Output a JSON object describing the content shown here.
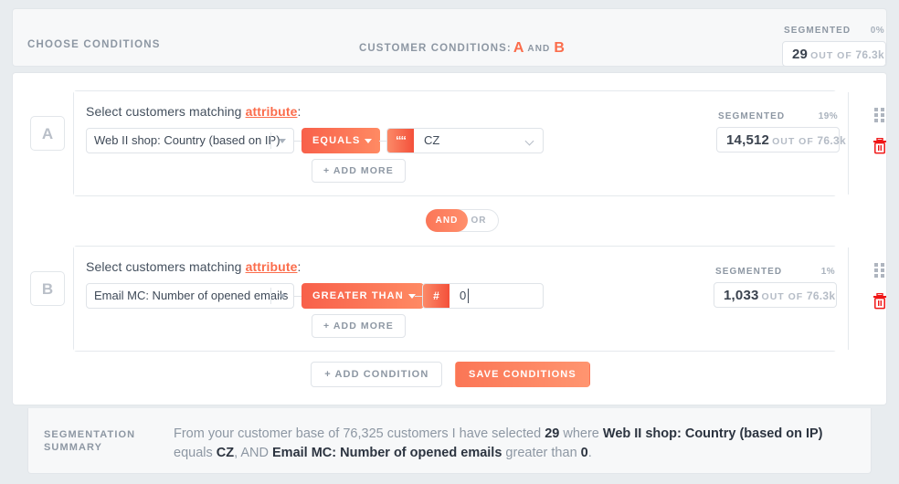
{
  "header": {
    "choose_conditions_label": "CHOOSE CONDITIONS",
    "customer_conditions_label": "CUSTOMER CONDITIONS:",
    "condition_a_letter": "A",
    "condition_and_word": "AND",
    "condition_b_letter": "B",
    "segmented": {
      "label": "SEGMENTED",
      "percent": "0%",
      "count": "29",
      "out_of_label": "OUT OF",
      "total": "76.3k"
    }
  },
  "conditions": [
    {
      "badge": "A",
      "title_prefix": "Select customers matching ",
      "title_link": "attribute",
      "title_suffix": ":",
      "attribute": "Web II shop: Country (based on IP)",
      "operator": "EQUALS",
      "value_type_icon": "quote-icon",
      "value_type_glyph": "““",
      "value": "CZ",
      "add_more_label": "+ ADD MORE",
      "segmented": {
        "label": "SEGMENTED",
        "percent": "19%",
        "count": "14,512",
        "out_of_label": "OUT OF",
        "total": "76.3k"
      },
      "drag_icon": "drag-handle-icon",
      "delete_icon": "trash-icon"
    },
    {
      "badge": "B",
      "title_prefix": "Select customers matching ",
      "title_link": "attribute",
      "title_suffix": ":",
      "attribute": "Email MC: Number of opened emails",
      "operator": "GREATER THAN",
      "value_type_icon": "number-icon",
      "value_type_glyph": "#",
      "value": "0",
      "add_more_label": "+ ADD MORE",
      "segmented": {
        "label": "SEGMENTED",
        "percent": "1%",
        "count": "1,033",
        "out_of_label": "OUT OF",
        "total": "76.3k"
      },
      "drag_icon": "drag-handle-icon",
      "delete_icon": "trash-icon"
    }
  ],
  "logic_toggle": {
    "active": "AND",
    "inactive": "OR"
  },
  "actions": {
    "add_condition_label": "+ ADD CONDITION",
    "save_conditions_label": "SAVE CONDITIONS"
  },
  "summary": {
    "label_line1": "SEGMENTATION",
    "label_line2": "SUMMARY",
    "seg_1": "From your customer base of 76,325 customers I have selected ",
    "seg_2": "29",
    "seg_3": " where ",
    "seg_4": "Web II shop: Country (based on IP)",
    "seg_5": " equals ",
    "seg_6": "CZ",
    "seg_7": ", AND ",
    "seg_8": "Email MC: Number of opened emails",
    "seg_9": " greater than ",
    "seg_10": "0",
    "seg_11": "."
  },
  "colors": {
    "accent": "#fb6d4c",
    "accent_dark": "#f4503a",
    "accent_light": "#ff9570",
    "danger": "#f01616",
    "page_bg": "#e8ecef",
    "muted_text": "#8d97a3"
  }
}
